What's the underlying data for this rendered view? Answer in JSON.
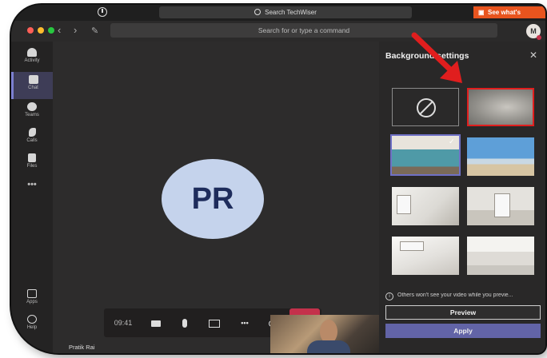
{
  "browser": {
    "search_text": "Search TechWiser",
    "promo_text": "See what's"
  },
  "header": {
    "command_placeholder": "Search for or type a command",
    "avatar_initial": "M",
    "back_glyph": "‹",
    "forward_glyph": "›",
    "compose_glyph": "✎"
  },
  "rail": {
    "items": [
      {
        "label": "Activity",
        "icon": "bell-icon"
      },
      {
        "label": "Chat",
        "icon": "chat-icon"
      },
      {
        "label": "Teams",
        "icon": "teams-icon"
      },
      {
        "label": "Calls",
        "icon": "phone-icon"
      },
      {
        "label": "Files",
        "icon": "file-icon"
      },
      {
        "label": "•••",
        "icon": "more-icon"
      }
    ],
    "bottom_items": [
      {
        "label": "Apps",
        "icon": "apps-icon"
      },
      {
        "label": "Help",
        "icon": "help-icon"
      }
    ]
  },
  "call": {
    "initials": "PR",
    "timer": "09:41",
    "participant_name": "Pratik Rai",
    "controls": {
      "video_glyph": "▬◂",
      "mic_glyph": "🎙",
      "share_glyph": "⇪",
      "more_glyph": "•••",
      "participants_glyph": "👥",
      "hangup_glyph": "☎"
    }
  },
  "panel": {
    "title": "Background settings",
    "close_glyph": "✕",
    "check_glyph": "✓",
    "info_text": "Others won't see your video while you previe...",
    "info_glyph": "i",
    "preview_label": "Preview",
    "apply_label": "Apply"
  },
  "colors": {
    "accent": "#6264a7",
    "end_call": "#c4314b",
    "highlight": "#e01e1e",
    "promo": "#e8541e"
  }
}
